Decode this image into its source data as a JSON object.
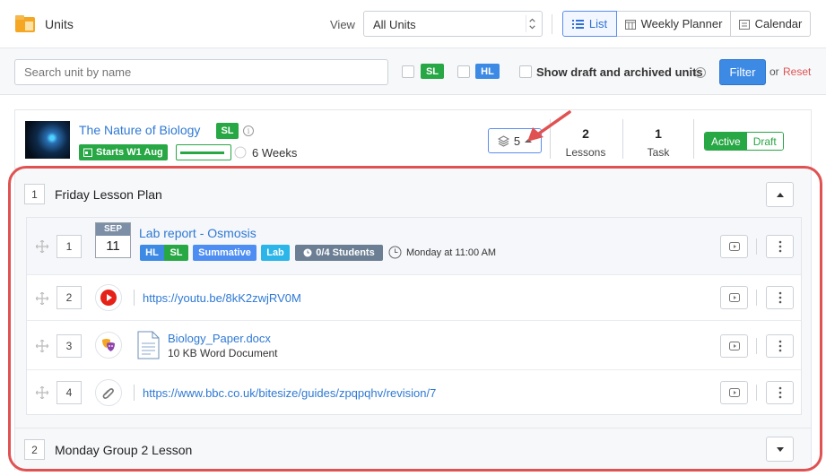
{
  "header": {
    "title": "Units",
    "view_label": "View",
    "view_selected": "All Units",
    "buttons": {
      "list": "List",
      "weekly_planner": "Weekly Planner",
      "calendar": "Calendar"
    }
  },
  "filters": {
    "search_placeholder": "Search unit by name",
    "sl": "SL",
    "hl": "HL",
    "show_draft": "Show draft and archived units",
    "filter_btn": "Filter",
    "or": "or",
    "reset": "Reset"
  },
  "unit": {
    "title": "The Nature of Biology",
    "level": "SL",
    "starts": "Starts W1 Aug",
    "progress": 0.9,
    "duration": "6 Weeks",
    "layers_count": "5",
    "lessons_count": "2",
    "lessons_label": "Lessons",
    "task_count": "1",
    "task_label": "Task",
    "status_active": "Active",
    "status_draft": "Draft"
  },
  "lesson_plans": [
    {
      "num": "1",
      "title": "Friday Lesson Plan",
      "items": [
        {
          "num": "1",
          "date_month": "SEP",
          "date_day": "11",
          "title": "Lab report - Osmosis",
          "badges": [
            "HL",
            "SL",
            "Summative",
            "Lab",
            "0/4 Students"
          ],
          "time": "Monday at 11:00 AM"
        },
        {
          "num": "2",
          "icon": "youtube-icon",
          "link": "https://youtu.be/8kK2zwjRV0M"
        },
        {
          "num": "3",
          "icon": "document-icon",
          "file_name": "Biology_Paper.docx",
          "file_meta": "10 KB Word Document"
        },
        {
          "num": "4",
          "icon": "attachment-icon",
          "link": "https://www.bbc.co.uk/bitesize/guides/zpqpqhv/revision/7"
        }
      ]
    },
    {
      "num": "2",
      "title": "Monday Group 2 Lesson"
    }
  ],
  "colors": {
    "accent": "#3d8ae5",
    "green": "#28a745",
    "annotation": "#e05252"
  }
}
